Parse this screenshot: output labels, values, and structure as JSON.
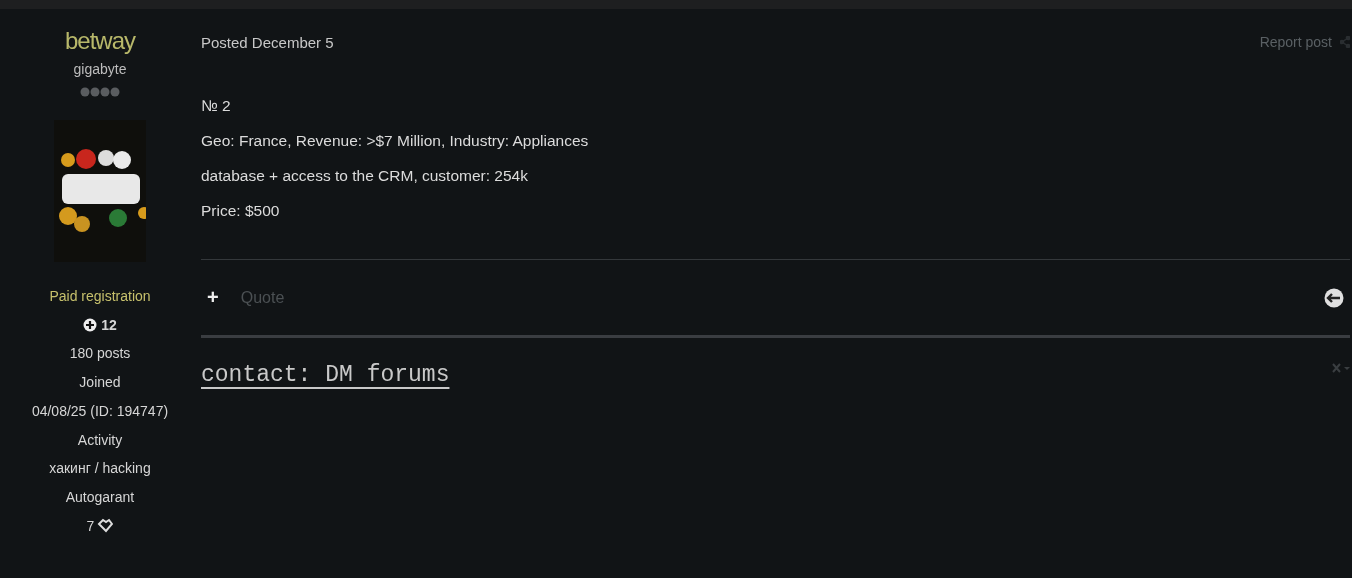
{
  "author": {
    "name": "betway",
    "title": "gigabyte",
    "group": "Paid registration",
    "reputation": "12",
    "posts": "180 posts",
    "joined_label": "Joined",
    "joined": "04/08/25 (ID: 194747)",
    "activity_label": "Activity",
    "activity": "хакинг / hacking",
    "autogarant_label": "Autogarant",
    "autogarant": "7"
  },
  "post": {
    "date": "Posted December 5",
    "report": "Report post",
    "lines": [
      "№ 2",
      "Geo: France, Revenue: >$7 Million, Industry: Appliances",
      "database + access to the CRM, customer: 254k",
      "Price: $500"
    ],
    "actions": {
      "plus": "+",
      "quote": "Quote"
    },
    "signature": "contact: DM forums"
  }
}
